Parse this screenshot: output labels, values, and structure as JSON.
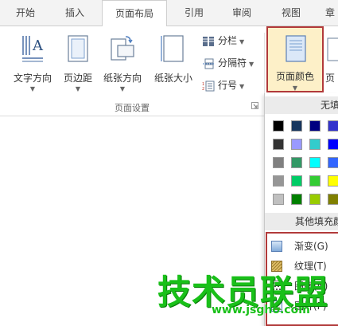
{
  "tabs": [
    {
      "label": "开始"
    },
    {
      "label": "插入"
    },
    {
      "label": "页面布局",
      "active": true
    },
    {
      "label": "引用"
    },
    {
      "label": "审阅"
    },
    {
      "label": "视图"
    },
    {
      "label": "章"
    }
  ],
  "ribbon": {
    "text_direction": "文字方向",
    "margins": "页边距",
    "orientation": "纸张方向",
    "paper_size": "纸张大小",
    "columns": "分栏",
    "breaks": "分隔符",
    "line_numbers": "行号",
    "page_color": "页面颜色",
    "page_border_cut": "页",
    "group_label": "页面设置"
  },
  "dropdown": {
    "no_fill": "无填",
    "more_fill": "其他填充颜",
    "colors": [
      [
        "#000000",
        "#17365d",
        "#000080",
        "#3333cc"
      ],
      [
        "#333333",
        "#9999ff",
        "#33cccc",
        "#0000ff"
      ],
      [
        "#808080",
        "#339966",
        "#00ffff",
        "#3366ff"
      ],
      [
        "#969696",
        "#00cc66",
        "#33cc33",
        "#ffff00"
      ],
      [
        "#c0c0c0",
        "#008000",
        "#99cc00",
        "#808000"
      ]
    ],
    "items": [
      {
        "label": "渐变(G)",
        "icon": "gradient-icon"
      },
      {
        "label": "纹理(T)",
        "icon": "texture-icon"
      },
      {
        "label": "图案(N)",
        "icon": "pattern-icon"
      },
      {
        "label": "图片(P)",
        "icon": "picture-icon"
      }
    ]
  },
  "watermark": {
    "main": "技术员联盟",
    "url": "www.jsgho.com"
  },
  "colors": {
    "highlight_border": "#b23a3a",
    "active_button_bg": "#fdf0c8",
    "watermark_green": "#19c019"
  }
}
